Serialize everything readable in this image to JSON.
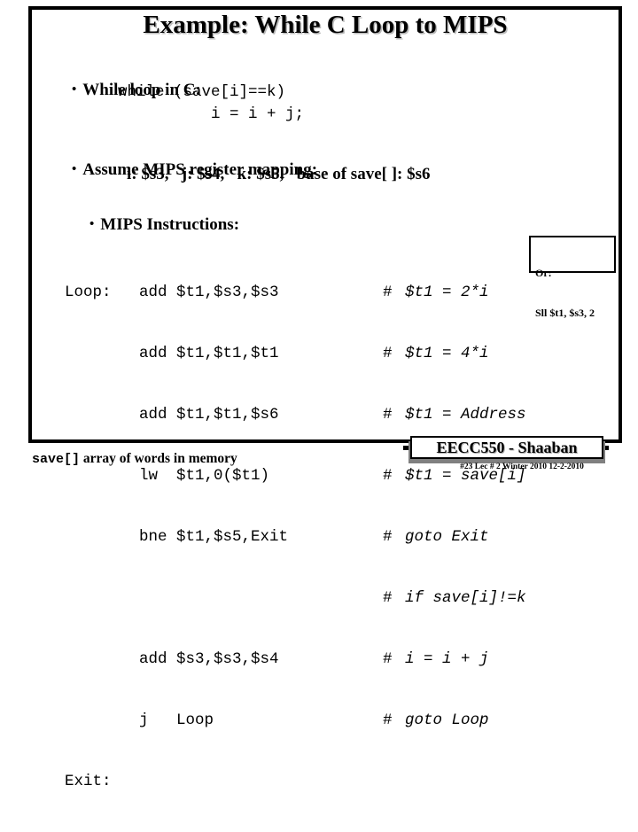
{
  "slide": {
    "title": "Example: While C Loop to MIPS",
    "bullets": {
      "while_loop_in_c": "While loop in C:",
      "assume_register_mapping": "Assume MIPS register mapping:",
      "mips_instructions": "MIPS Instructions:"
    },
    "c_code": {
      "line1": "while (save[i]==k)",
      "line2": "i = i + j;"
    },
    "register_mapping": "i: $s3,   j: $s4,   k: $s5,   base of save[ ]: $s6",
    "code": {
      "labels": [
        "Loop:",
        "",
        "",
        "",
        "",
        "",
        "",
        "",
        "Exit:"
      ],
      "instructions": [
        "add $t1,$s3,$s3",
        "add $t1,$t1,$t1",
        "add $t1,$t1,$s6",
        "lw  $t1,0($t1)",
        "bne $t1,$s5,Exit",
        "",
        "add $s3,$s3,$s4",
        "j   Loop",
        ""
      ],
      "comments": [
        "$t1 = 2*i",
        "$t1 = 4*i",
        "$t1 = Address",
        "$t1 = save[i]",
        "goto Exit",
        "if save[i]!=k",
        "i = i + j",
        "goto Loop",
        ""
      ],
      "comment_marker": "#"
    },
    "or_box": {
      "label": "Or:",
      "instruction": "Sll $t1, $s3, 2"
    },
    "caption": {
      "mono_part": "save[]",
      "text_part": " array of words in memory"
    },
    "footer": {
      "course": "EECC550 - Shaaban",
      "meta": "#23   Lec # 2   Winter 2010  12-2-2010"
    },
    "colors": {
      "background": "#ffffff",
      "text": "#000000",
      "shadow": "#b9b9b9",
      "badge_shadow": "#808080"
    }
  }
}
